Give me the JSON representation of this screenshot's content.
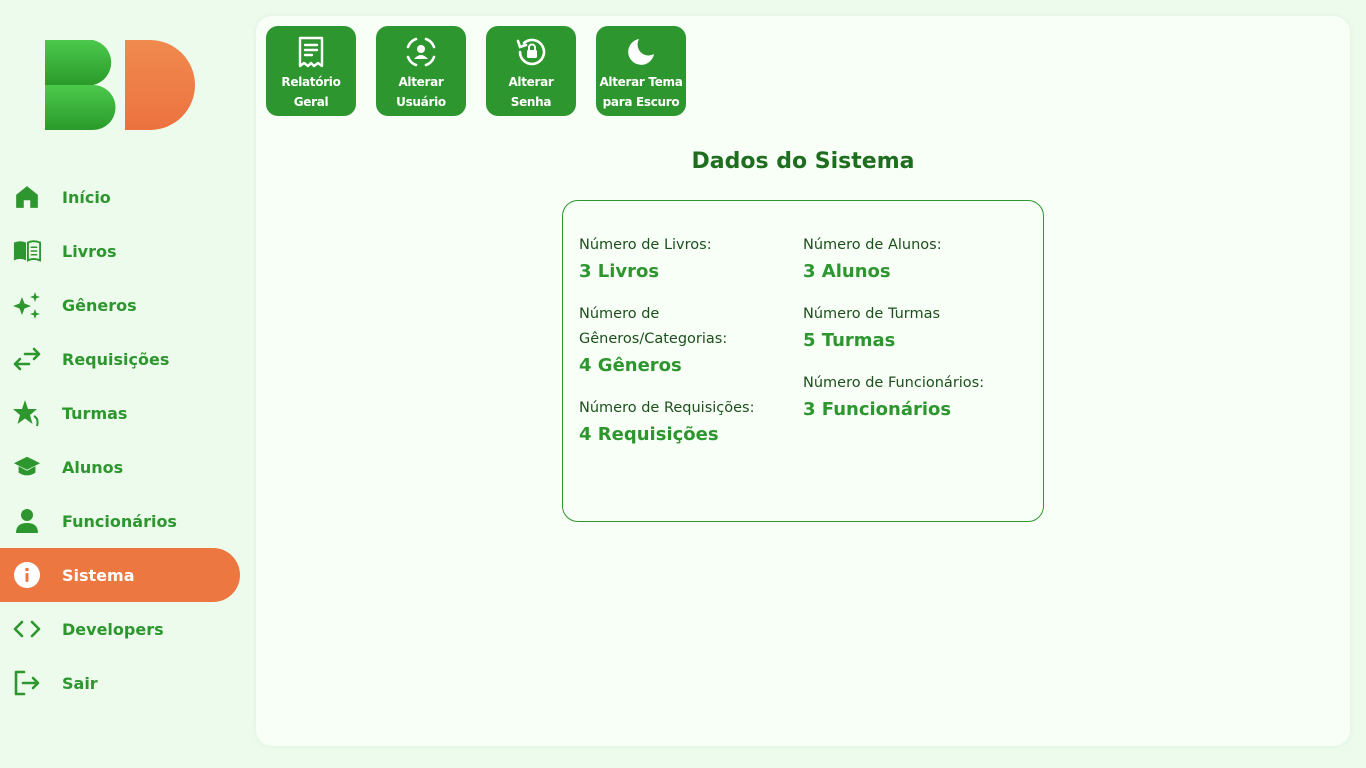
{
  "app": {
    "logo_text": "BD"
  },
  "sidebar": {
    "items": [
      {
        "label": "Início",
        "icon": "home-icon"
      },
      {
        "label": "Livros",
        "icon": "book-icon"
      },
      {
        "label": "Gêneros",
        "icon": "sparkles-icon"
      },
      {
        "label": "Requisições",
        "icon": "swap-arrows-icon"
      },
      {
        "label": "Turmas",
        "icon": "star-icon"
      },
      {
        "label": "Alunos",
        "icon": "graduation-cap-icon"
      },
      {
        "label": "Funcionários",
        "icon": "person-icon"
      },
      {
        "label": "Sistema",
        "icon": "info-icon",
        "active": true
      },
      {
        "label": "Developers",
        "icon": "code-icon"
      },
      {
        "label": "Sair",
        "icon": "logout-icon"
      }
    ]
  },
  "toolbar": {
    "buttons": [
      {
        "label": "Relatório\nGeral",
        "icon": "receipt-icon"
      },
      {
        "label": "Alterar\nUsuário",
        "icon": "user-scan-icon"
      },
      {
        "label": "Alterar\nSenha",
        "icon": "lock-reset-icon"
      },
      {
        "label": "Alterar Tema\npara Escuro",
        "icon": "moon-icon"
      }
    ]
  },
  "main": {
    "title": "Dados do Sistema",
    "stats_left": [
      {
        "label": "Número de Livros:",
        "value": "3 Livros"
      },
      {
        "label": "Número de\nGêneros/Categorias:",
        "value": "4 Gêneros"
      },
      {
        "label": "Número de Requisições:",
        "value": "4 Requisições"
      }
    ],
    "stats_right": [
      {
        "label": "Número de Alunos:",
        "value": "3 Alunos"
      },
      {
        "label": "Número de Turmas",
        "value": "5 Turmas"
      },
      {
        "label": "Número de Funcionários:",
        "value": "3 Funcionários"
      }
    ]
  },
  "colors": {
    "primary_green": "#2e962e",
    "dark_green": "#1f6e1f",
    "accent_orange": "#ec7740",
    "background": "#ecfbec",
    "panel": "#f7fff7"
  }
}
